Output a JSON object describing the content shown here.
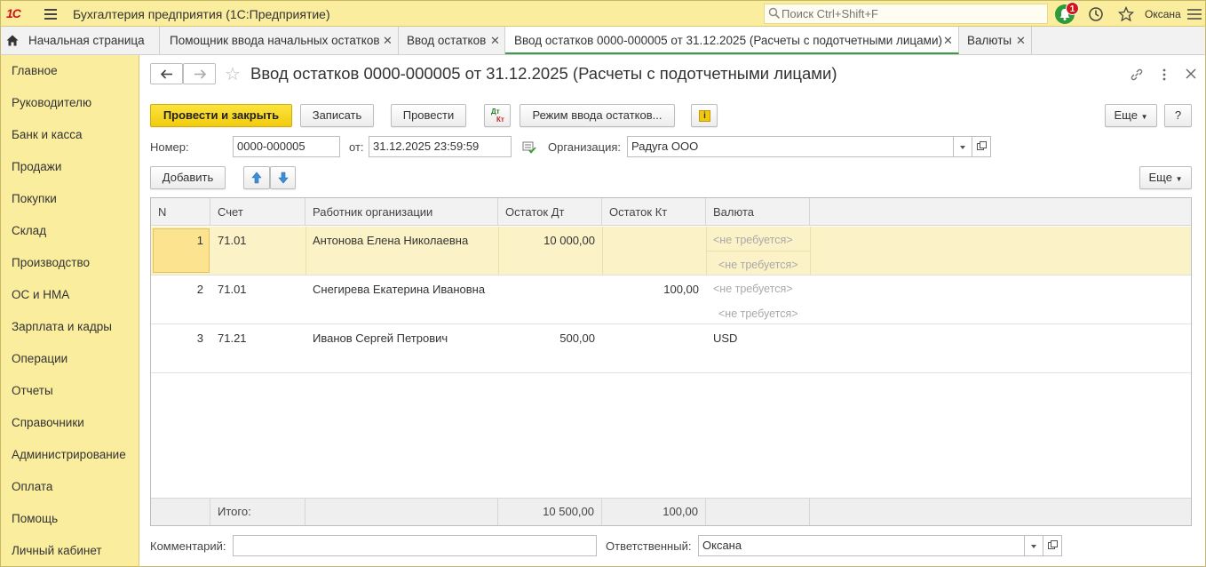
{
  "app": {
    "logo": "1С",
    "title": "Бухгалтерия предприятия  (1С:Предприятие)",
    "search_placeholder": "Поиск Ctrl+Shift+F",
    "notifications_count": "1",
    "user": "Оксана"
  },
  "tabs": [
    {
      "label": "Начальная страница",
      "active": false
    },
    {
      "label": "Помощник ввода начальных остатков",
      "active": false
    },
    {
      "label": "Ввод остатков",
      "active": false
    },
    {
      "label": "Ввод остатков 0000-000005 от 31.12.2025 (Расчеты с подотчетными лицами)",
      "active": true
    },
    {
      "label": "Валюты",
      "active": false
    }
  ],
  "sidebar": {
    "items": [
      {
        "label": "Главное"
      },
      {
        "label": "Руководителю"
      },
      {
        "label": "Банк и касса"
      },
      {
        "label": "Продажи"
      },
      {
        "label": "Покупки"
      },
      {
        "label": "Склад"
      },
      {
        "label": "Производство"
      },
      {
        "label": "ОС и НМА"
      },
      {
        "label": "Зарплата и кадры"
      },
      {
        "label": "Операции"
      },
      {
        "label": "Отчеты"
      },
      {
        "label": "Справочники"
      },
      {
        "label": "Администрирование"
      },
      {
        "label": "Оплата"
      },
      {
        "label": "Помощь"
      },
      {
        "label": "Личный кабинет"
      }
    ]
  },
  "form": {
    "title": "Ввод остатков 0000-000005 от 31.12.2025 (Расчеты с подотчетными лицами)",
    "toolbar": {
      "post_close": "Провести и закрыть",
      "save": "Записать",
      "post": "Провести",
      "dt_kt_top": "Дт",
      "dt_kt_bottom": "Кт",
      "mode": "Режим ввода остатков...",
      "more": "Еще",
      "help": "?"
    },
    "number_label": "Номер:",
    "number_value": "0000-000005",
    "date_label": "от:",
    "date_value": "31.12.2025 23:59:59",
    "org_label": "Организация:",
    "org_value": "Радуга ООО",
    "add_button": "Добавить",
    "table_more": "Еще",
    "table": {
      "columns": [
        "N",
        "Счет",
        "Работник организации",
        "Остаток Дт",
        "Остаток Кт",
        "Валюта"
      ],
      "rows": [
        {
          "n": "1",
          "account": "71.01",
          "employee": "Антонова Елена Николаевна",
          "dt": "10 000,00",
          "kt": "",
          "currency": "<не требуется>",
          "currency2": "<не требуется>",
          "selected": true
        },
        {
          "n": "2",
          "account": "71.01",
          "employee": "Снегирева Екатерина Ивановна",
          "dt": "",
          "kt": "100,00",
          "currency": "<не требуется>",
          "currency2": "<не требуется>",
          "selected": false
        },
        {
          "n": "3",
          "account": "71.21",
          "employee": "Иванов Сергей Петрович",
          "dt": "500,00",
          "kt": "",
          "currency": "USD",
          "currency2": "",
          "selected": false
        }
      ],
      "totals": {
        "label": "Итого:",
        "dt": "10 500,00",
        "kt": "100,00"
      }
    },
    "comment_label": "Комментарий:",
    "comment_value": "",
    "responsible_label": "Ответственный:",
    "responsible_value": "Оксана"
  }
}
